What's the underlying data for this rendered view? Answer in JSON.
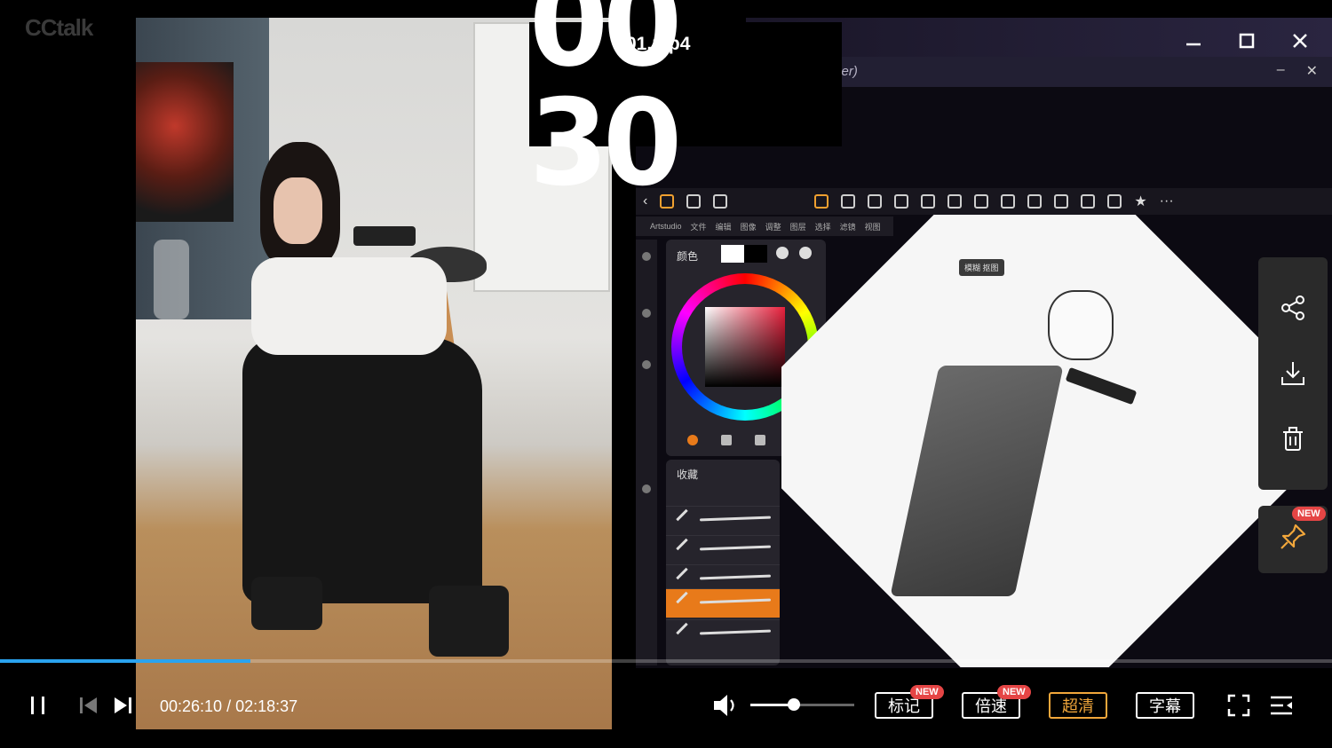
{
  "app": {
    "logo": "CCtalk",
    "file_title": "01.mp4",
    "window_buttons": [
      "minimize-icon",
      "maximize-icon",
      "close-icon"
    ]
  },
  "overlay": {
    "timer": "00 30"
  },
  "inner_app": {
    "title_suffix": "yer)",
    "menu": [
      "Artstudio",
      "文件",
      "编辑",
      "图像",
      "调整",
      "图层",
      "选择",
      "滤镜",
      "视图"
    ],
    "color_panel_label": "颜色",
    "brush_panel_label": "收藏",
    "tooltip": "模糊 抠图"
  },
  "player": {
    "current_time": "00:26:10",
    "total_time": "02:18:37",
    "time_display": "00:26:10 / 02:18:37",
    "progress": 0.188,
    "volume": 0.42,
    "buttons": {
      "mark": "标记",
      "speed": "倍速",
      "quality": "超清",
      "subtitle": "字幕"
    },
    "new_badge": "NEW"
  },
  "colors": {
    "accent": "#2aa3ef",
    "quality_active": "#f2a73b",
    "badge": "#e54545"
  }
}
